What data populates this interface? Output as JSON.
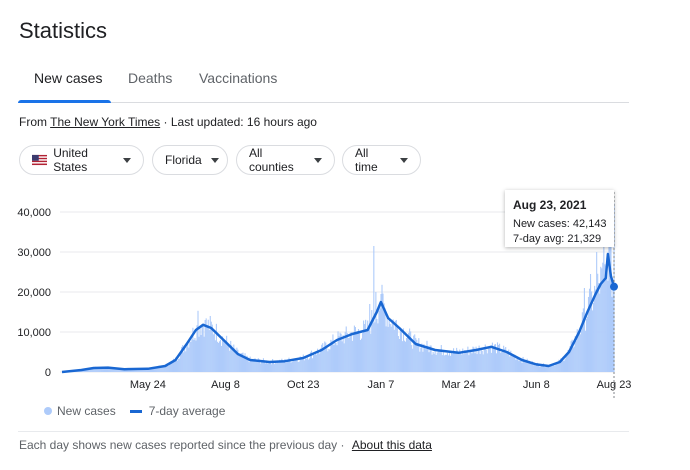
{
  "title": "Statistics",
  "tabs": [
    {
      "label": "New cases",
      "active": true
    },
    {
      "label": "Deaths",
      "active": false
    },
    {
      "label": "Vaccinations",
      "active": false
    }
  ],
  "source": {
    "prefix": "From",
    "link": "The New York Times",
    "separator": "·",
    "updated": "Last updated: 16 hours ago"
  },
  "filters": [
    {
      "label": "United States",
      "icon": "us-flag-icon"
    },
    {
      "label": "Florida"
    },
    {
      "label": "All counties"
    },
    {
      "label": "All time"
    }
  ],
  "tooltip": {
    "date": "Aug 23, 2021",
    "new_cases": "New cases: 42,143",
    "avg": "7-day avg: 21,329"
  },
  "legend": {
    "new_cases": "New cases",
    "avg": "7-day average"
  },
  "footer": {
    "text": "Each day shows new cases reported since the previous day",
    "separator": "·",
    "link": "About this data"
  },
  "colors": {
    "bars": "#aecbfa",
    "line": "#1967d2",
    "accent": "#1a73e8",
    "grid": "#e8eaed"
  },
  "chart_data": {
    "type": "bar",
    "x_start": "2020-03-01",
    "x_end": "2021-08-23",
    "ylim": [
      0,
      40000
    ],
    "yticks": [
      0,
      10000,
      20000,
      30000,
      40000
    ],
    "ytick_labels": [
      "0",
      "10,000",
      "20,000",
      "30,000",
      "40,000"
    ],
    "xticks": [
      {
        "date": "2020-05-24",
        "label": "May 24"
      },
      {
        "date": "2020-08-08",
        "label": "Aug 8"
      },
      {
        "date": "2020-10-23",
        "label": "Oct 23"
      },
      {
        "date": "2021-01-07",
        "label": "Jan 7"
      },
      {
        "date": "2021-03-24",
        "label": "Mar 24"
      },
      {
        "date": "2021-06-08",
        "label": "Jun 8"
      },
      {
        "date": "2021-08-23",
        "label": "Aug 23"
      }
    ],
    "series": [
      {
        "name": "7-day average",
        "style": "line",
        "points": [
          [
            "2020-03-01",
            0
          ],
          [
            "2020-03-20",
            500
          ],
          [
            "2020-04-01",
            1000
          ],
          [
            "2020-04-15",
            1100
          ],
          [
            "2020-05-01",
            700
          ],
          [
            "2020-05-24",
            800
          ],
          [
            "2020-06-10",
            1500
          ],
          [
            "2020-06-20",
            3000
          ],
          [
            "2020-07-01",
            7000
          ],
          [
            "2020-07-10",
            10500
          ],
          [
            "2020-07-17",
            11800
          ],
          [
            "2020-07-25",
            11000
          ],
          [
            "2020-08-08",
            7500
          ],
          [
            "2020-08-20",
            4500
          ],
          [
            "2020-09-01",
            3000
          ],
          [
            "2020-09-20",
            2500
          ],
          [
            "2020-10-05",
            2700
          ],
          [
            "2020-10-23",
            3500
          ],
          [
            "2020-11-10",
            5500
          ],
          [
            "2020-11-25",
            8000
          ],
          [
            "2020-12-10",
            9500
          ],
          [
            "2020-12-25",
            10500
          ],
          [
            "2021-01-03",
            15000
          ],
          [
            "2021-01-07",
            17500
          ],
          [
            "2021-01-14",
            13500
          ],
          [
            "2021-01-25",
            11000
          ],
          [
            "2021-02-10",
            7000
          ],
          [
            "2021-03-01",
            5500
          ],
          [
            "2021-03-24",
            4800
          ],
          [
            "2021-04-10",
            5500
          ],
          [
            "2021-04-25",
            6300
          ],
          [
            "2021-05-10",
            5000
          ],
          [
            "2021-05-25",
            3000
          ],
          [
            "2021-06-08",
            1900
          ],
          [
            "2021-06-20",
            1500
          ],
          [
            "2021-07-01",
            2500
          ],
          [
            "2021-07-10",
            5000
          ],
          [
            "2021-07-20",
            10000
          ],
          [
            "2021-07-28",
            15000
          ],
          [
            "2021-08-05",
            19500
          ],
          [
            "2021-08-10",
            22000
          ],
          [
            "2021-08-15",
            23500
          ],
          [
            "2021-08-17",
            29500
          ],
          [
            "2021-08-20",
            24000
          ],
          [
            "2021-08-23",
            21329
          ]
        ]
      },
      {
        "name": "New cases",
        "style": "bars",
        "spikes": [
          [
            "2020-07-12",
            15300
          ],
          [
            "2020-07-19",
            13000
          ],
          [
            "2020-12-27",
            17000
          ],
          [
            "2020-12-31",
            31500
          ],
          [
            "2021-01-02",
            20000
          ],
          [
            "2021-01-07",
            19500
          ],
          [
            "2021-07-25",
            21000
          ],
          [
            "2021-07-31",
            24500
          ],
          [
            "2021-08-06",
            30000
          ],
          [
            "2021-08-13",
            33000
          ],
          [
            "2021-08-20",
            35000
          ],
          [
            "2021-08-23",
            42143
          ]
        ]
      }
    ]
  }
}
